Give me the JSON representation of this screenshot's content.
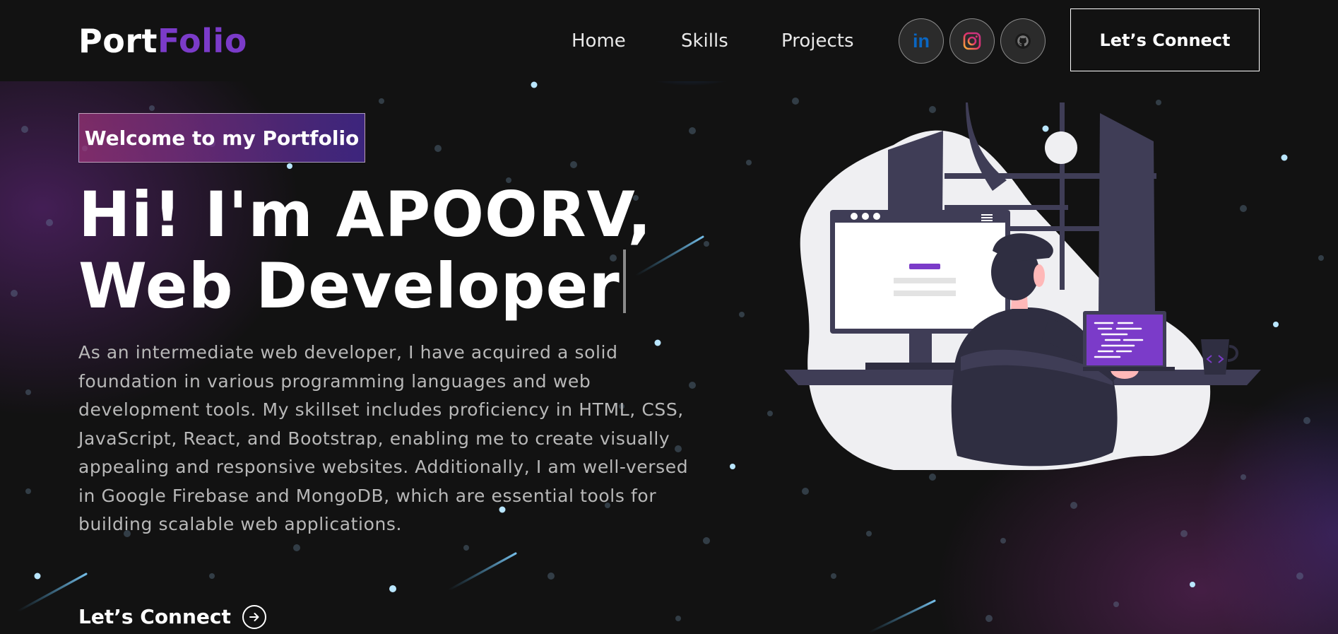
{
  "navbar": {
    "logo_part1": "Port",
    "logo_part2": "Folio",
    "links": [
      "Home",
      "Skills",
      "Projects"
    ],
    "socials": [
      {
        "name": "linkedin-icon",
        "label": "in"
      },
      {
        "name": "instagram-icon"
      },
      {
        "name": "github-icon"
      }
    ],
    "connect_label": "Let’s Connect"
  },
  "hero": {
    "tagline": "Welcome to my Portfolio",
    "headline_line1": "Hi! I'm APOORV,",
    "headline_line2": "Web Developer",
    "bio_lines": [
      "As an intermediate web developer, I have acquired a solid",
      "foundation in various programming languages and web",
      "development tools. My skillset includes proficiency in HTML, CSS,",
      "JavaScript, React, and Bootstrap, enabling me to create visually",
      "appealing and responsive websites. Additionally, I am well-versed",
      "in Google Firebase and MongoDB, which are essential tools for",
      "building scalable web applications."
    ],
    "cta_label": "Let’s Connect",
    "cta_icon": "arrow-right-circle-icon"
  },
  "colors": {
    "background": "#121212",
    "accent": "#7b3bc9",
    "linkedin": "#0a66c2",
    "tagline_gradient_start": "#aa367c",
    "tagline_gradient_end": "#4a2fbd"
  }
}
